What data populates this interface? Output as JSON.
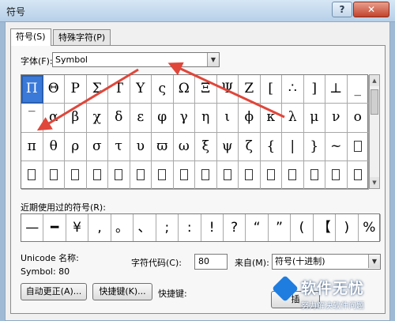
{
  "window": {
    "title": "符号",
    "help_label": "?",
    "close_label": "✕"
  },
  "tabs": [
    {
      "label": "符号(S)"
    },
    {
      "label": "特殊字符(P)"
    }
  ],
  "font": {
    "label": "字体(F):",
    "value": "Symbol"
  },
  "symbols": [
    [
      "Π",
      "Θ",
      "Ρ",
      "Σ",
      "Τ",
      "Υ",
      "ς",
      "Ω",
      "Ξ",
      "Ψ",
      "Ζ",
      "[",
      "∴",
      "]",
      "⊥",
      "_"
    ],
    [
      "‾",
      "α",
      "β",
      "χ",
      "δ",
      "ε",
      "φ",
      "γ",
      "η",
      "ι",
      "ϕ",
      "κ",
      "λ",
      "μ",
      "ν",
      "ο"
    ],
    [
      "π",
      "θ",
      "ρ",
      "σ",
      "τ",
      "υ",
      "ϖ",
      "ω",
      "ξ",
      "ψ",
      "ζ",
      "{",
      "|",
      "}",
      "~",
      ""
    ],
    [
      "",
      "",
      "",
      "",
      "",
      "",
      "",
      "",
      "",
      "",
      "",
      "",
      "",
      "",
      "",
      ""
    ]
  ],
  "recent": {
    "label": "近期使用过的符号(R):",
    "items": [
      "—",
      "━",
      "¥",
      ",",
      "。",
      "、",
      ";",
      ":",
      "!",
      "?",
      "“",
      "”",
      "(",
      "【",
      ")",
      "%"
    ]
  },
  "unicode": {
    "name_label": "Unicode 名称:",
    "symbol_text": "Symbol: 80"
  },
  "charcode": {
    "label": "字符代码(C):",
    "value": "80"
  },
  "from": {
    "label": "来自(M):",
    "value": "符号(十进制)"
  },
  "buttons": {
    "autocorrect": "自动更正(A)...",
    "shortcut_key": "快捷键(K)...",
    "shortcut_label": "快捷键:",
    "insert_partial": "插"
  },
  "watermark": {
    "title": "软件无忧",
    "subtitle": "努力解决软件问题"
  },
  "colors": {
    "selected": "#3a79d8",
    "arrow": "#e0463a"
  }
}
